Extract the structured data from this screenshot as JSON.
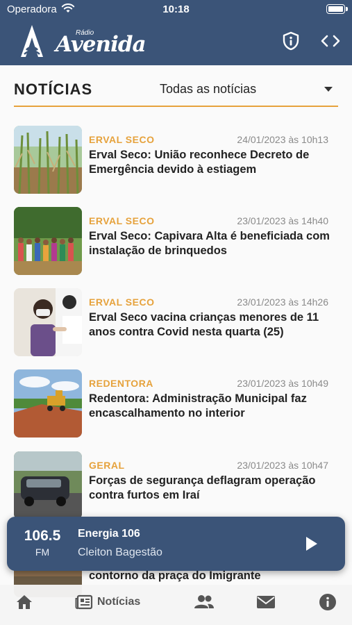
{
  "status_bar": {
    "carrier": "Operadora",
    "time": "10:18"
  },
  "header": {
    "logo_small": "Rádio",
    "logo_name": "Avenida"
  },
  "section": {
    "title": "NOTÍCIAS",
    "filter_value": "Todas as notícias"
  },
  "news": [
    {
      "category": "ERVAL SECO",
      "date": "24/01/2023 às 10h13",
      "title": "Erval Seco: União reconhece Decreto de Emergência devido à estiagem",
      "thumb": "cornfield"
    },
    {
      "category": "ERVAL SECO",
      "date": "23/01/2023 às 14h40",
      "title": "Erval Seco: Capivara Alta é beneficiada com instalação de brinquedos",
      "thumb": "group-outdoors"
    },
    {
      "category": "ERVAL SECO",
      "date": "23/01/2023 às 14h26",
      "title": "Erval Seco vacina crianças menores de 11 anos contra Covid nesta quarta (25)",
      "thumb": "vaccination"
    },
    {
      "category": "REDENTORA",
      "date": "23/01/2023 às 10h49",
      "title": "Redentora: Administração Municipal faz encascalhamento no interior",
      "thumb": "road-grader"
    },
    {
      "category": "GERAL",
      "date": "23/01/2023 às 10h47",
      "title": "Forças de segurança deflagram operação contra furtos em Iraí",
      "thumb": "police-car"
    }
  ],
  "peek_item": {
    "title": "contorno da praça do Imigrante"
  },
  "player": {
    "frequency": "106.5",
    "band": "FM",
    "station": "Energia 106",
    "host": "Cleiton Bagestão"
  },
  "tabs": [
    {
      "icon": "home-icon",
      "label": ""
    },
    {
      "icon": "newspaper-icon",
      "label": "Notícias"
    },
    {
      "icon": "people-icon",
      "label": ""
    },
    {
      "icon": "mail-icon",
      "label": ""
    },
    {
      "icon": "info-icon",
      "label": ""
    }
  ],
  "colors": {
    "brand_blue": "#3b5478",
    "accent_orange": "#e6a23c"
  }
}
